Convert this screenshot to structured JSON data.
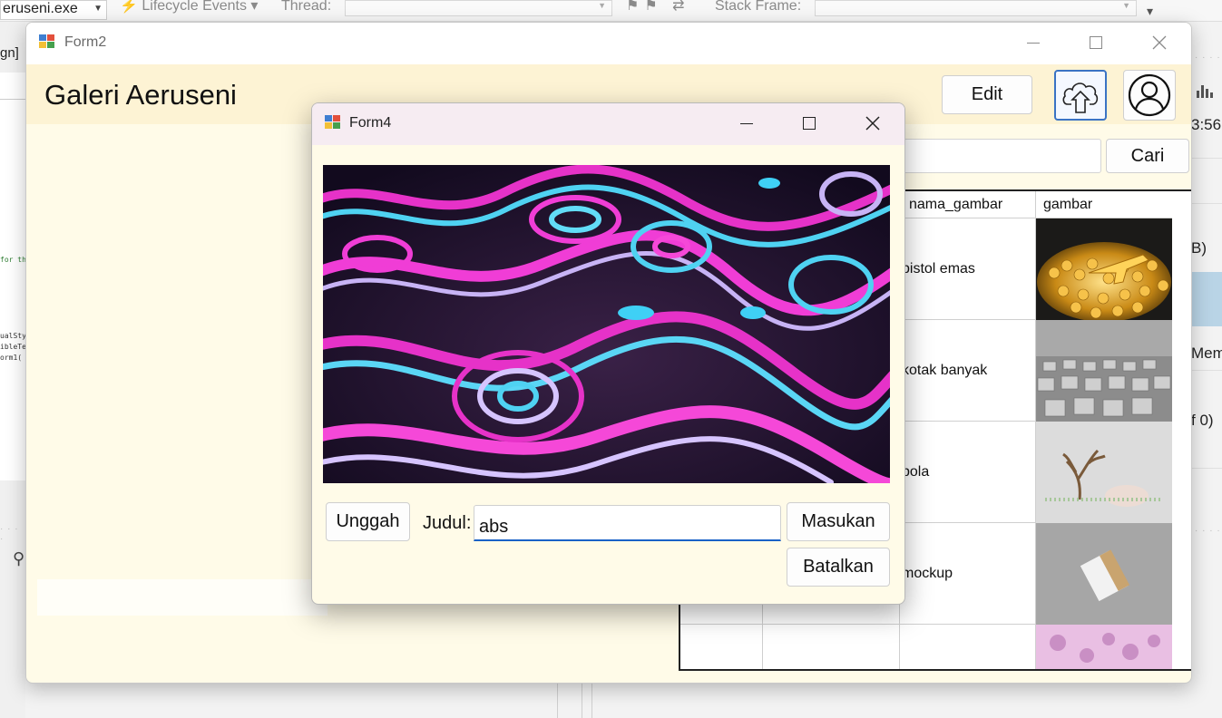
{
  "ide": {
    "process_label": "eruseni.exe",
    "lifecycle_label": "Lifecycle Events",
    "thread_label": "Thread:",
    "stack_frame_label": "Stack Frame:",
    "left_tab_label": "gn]",
    "code_line_1": "for th",
    "code_line_2": "ualSty",
    "code_line_3": "ibleTe",
    "code_line_4": "orm1(",
    "right_time": "3:56",
    "right_b": "B)",
    "right_mem": "Mem",
    "right_f0": "f 0)"
  },
  "form2": {
    "window_title": "Form2",
    "header_title": "Galeri Aeruseni",
    "edit_label": "Edit",
    "search_value": "",
    "search_button_label": "Cari",
    "grid": {
      "columns": [
        "nama_gambar",
        "gambar"
      ],
      "rows": [
        {
          "nama_gambar": "pistol emas"
        },
        {
          "nama_gambar": "kotak banyak"
        },
        {
          "nama_gambar": "bola"
        },
        {
          "nama_gambar": "mockup"
        },
        {
          "nama_gambar": ""
        }
      ]
    }
  },
  "form4": {
    "window_title": "Form4",
    "upload_label": "Unggah",
    "title_label": "Judul:",
    "title_value": "abs",
    "submit_label": "Masukan",
    "cancel_label": "Batalkan"
  },
  "colors": {
    "form_background": "#fffbe8",
    "header_background": "#fdf3d4",
    "accent_blue": "#1a62c7",
    "dialog_titlebar": "#f6ecf2"
  }
}
